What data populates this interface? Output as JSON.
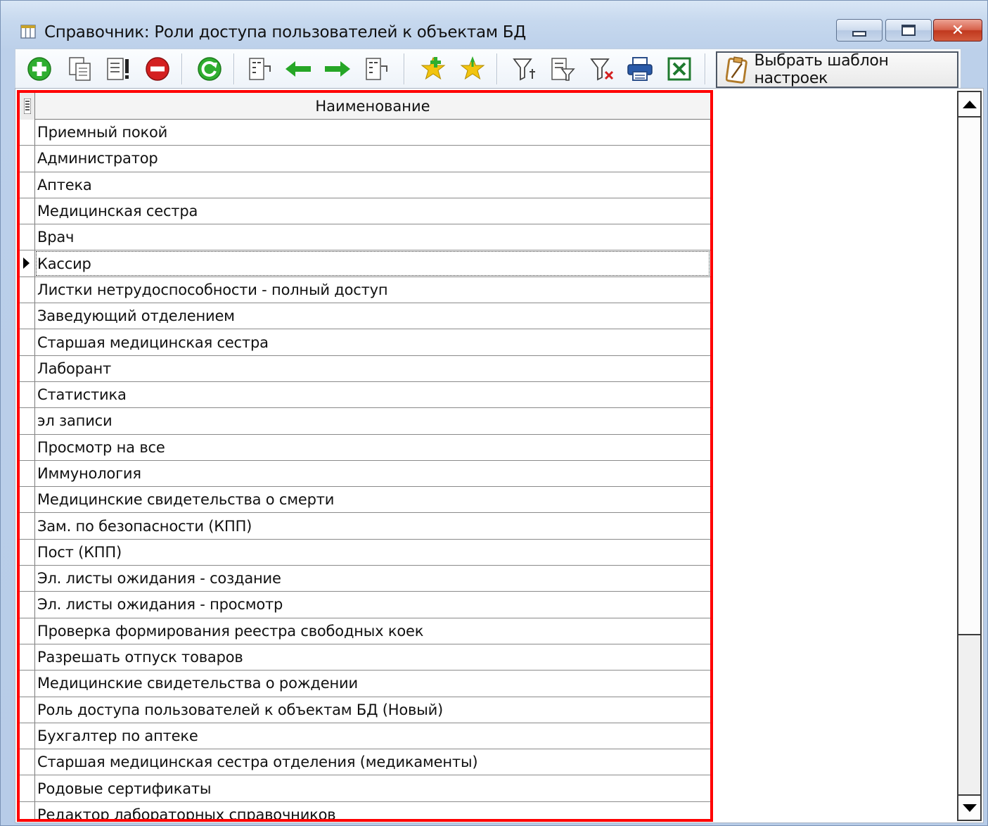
{
  "window": {
    "title": "Справочник: Роли доступа пользователей к объектам БД",
    "close_glyph": "✕"
  },
  "toolbar": {
    "buttons": [
      {
        "icon": "add-icon"
      },
      {
        "icon": "copy-icon"
      },
      {
        "icon": "edit-icon"
      },
      {
        "icon": "delete-icon"
      },
      {
        "icon": "refresh-icon"
      },
      {
        "icon": "move-left-list-icon"
      },
      {
        "icon": "arrow-left-icon"
      },
      {
        "icon": "arrow-right-icon"
      },
      {
        "icon": "move-right-list-icon"
      },
      {
        "icon": "add-favorite-icon"
      },
      {
        "icon": "favorites-icon"
      },
      {
        "icon": "filter-icon"
      },
      {
        "icon": "filter-edit-icon"
      },
      {
        "icon": "filter-clear-icon"
      },
      {
        "icon": "print-icon"
      },
      {
        "icon": "excel-icon"
      }
    ],
    "template_button_label": "Выбрать шаблон настроек"
  },
  "grid": {
    "column_header": "Наименование",
    "current_row_index": 5,
    "rows": [
      "Приемный покой",
      "Администратор",
      "Аптека",
      "Медицинская сестра",
      "Врач",
      "Кассир",
      "Листки нетрудоспособности - полный доступ",
      "Заведующий отделением",
      "Старшая медицинская сестра",
      "Лаборант",
      "Статистика",
      "эл записи",
      "Просмотр на все",
      "Иммунология",
      "Медицинские свидетельства о смерти",
      "Зам. по безопасности (КПП)",
      "Пост (КПП)",
      "Эл. листы ожидания - создание",
      "Эл. листы ожидания - просмотр",
      "Проверка формирования реестра свободных коек",
      "Разрешать отпуск товаров",
      "Медицинские свидетельства о рождении",
      "Роль доступа пользователей к объектам БД (Новый)",
      "Бухгалтер по аптеке",
      "Старшая медицинская сестра отделения (медикаменты)",
      "Родовые сертификаты",
      "Редактор лабораторных справочников"
    ]
  },
  "colors": {
    "highlight_border": "#ff0000",
    "add": "#2fae2f",
    "delete": "#d42020",
    "refresh": "#2fae2f",
    "arrow": "#26a626",
    "star": "#f2c40f"
  }
}
